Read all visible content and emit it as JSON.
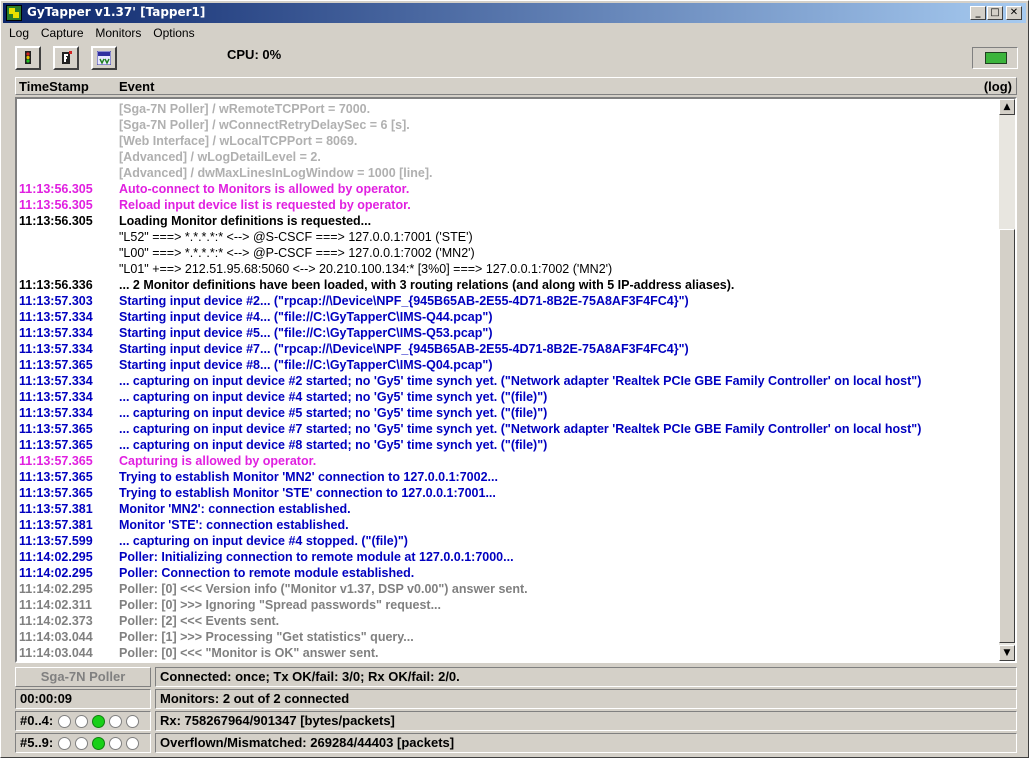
{
  "window": {
    "title": "GyTapper  v1.37'  [Tapper1]",
    "controls": {
      "minimize": "_",
      "maximize": "□",
      "close": "✕"
    }
  },
  "menu": [
    "Log",
    "Capture",
    "Monitors",
    "Options"
  ],
  "toolbar": {
    "buttons": [
      "traffic-light-icon",
      "phone-f-icon",
      "auto-capture-icon"
    ],
    "cpu_label": "CPU:  0%",
    "connection_icon": "plug-icon"
  },
  "log": {
    "columns": {
      "timestamp": "TimeStamp",
      "event": "Event",
      "right": "(log)"
    },
    "lines": [
      {
        "ts": "",
        "ev": "[Sga-7N Poller] / wRemoteTCPPort = 7000.",
        "color": "lightgray"
      },
      {
        "ts": "",
        "ev": "[Sga-7N Poller] / wConnectRetryDelaySec = 6 [s].",
        "color": "lightgray"
      },
      {
        "ts": "",
        "ev": "[Web Interface] / wLocalTCPPort = 8069.",
        "color": "lightgray"
      },
      {
        "ts": "",
        "ev": "[Advanced] / wLogDetailLevel = 2.",
        "color": "lightgray"
      },
      {
        "ts": "",
        "ev": "[Advanced] / dwMaxLinesInLogWindow = 1000 [line].",
        "color": "lightgray"
      },
      {
        "ts": "11:13:56.305",
        "ev": "Auto-connect to Monitors is allowed by operator.",
        "color": "magenta"
      },
      {
        "ts": "11:13:56.305",
        "ev": "Reload input device list is requested by operator.",
        "color": "magenta"
      },
      {
        "ts": "11:13:56.305",
        "ev": "Loading Monitor definitions is requested...",
        "color": "black"
      },
      {
        "ts": "",
        "ev": "\"L52\"  ===>  *.*.*.*:* <--> @S-CSCF  ===>  127.0.0.1:7001 ('STE')",
        "color": "black",
        "normal": true
      },
      {
        "ts": "",
        "ev": "\"L00\"  ===>  *.*.*.*:* <--> @P-CSCF  ===>  127.0.0.1:7002 ('MN2')",
        "color": "black",
        "normal": true
      },
      {
        "ts": "",
        "ev": "\"L01\"  +==>  212.51.95.68:5060 <--> 20.210.100.134:*  [3%0]  ===>  127.0.0.1:7002 ('MN2')",
        "color": "black",
        "normal": true
      },
      {
        "ts": "11:13:56.336",
        "ev": "... 2 Monitor definitions have been loaded, with 3 routing relations (and along with 5 IP-address aliases).",
        "color": "black"
      },
      {
        "ts": "11:13:57.303",
        "ev": "Starting input device #2...  (\"rpcap://\\Device\\NPF_{945B65AB-2E55-4D71-8B2E-75A8AF3F4FC4}\")",
        "color": "blue"
      },
      {
        "ts": "11:13:57.334",
        "ev": "Starting input device #4...  (\"file://C:\\GyTapperC\\IMS-Q44.pcap\")",
        "color": "blue"
      },
      {
        "ts": "11:13:57.334",
        "ev": "Starting input device #5...  (\"file://C:\\GyTapperC\\IMS-Q53.pcap\")",
        "color": "blue"
      },
      {
        "ts": "11:13:57.334",
        "ev": "Starting input device #7...  (\"rpcap://\\Device\\NPF_{945B65AB-2E55-4D71-8B2E-75A8AF3F4FC4}\")",
        "color": "blue"
      },
      {
        "ts": "11:13:57.365",
        "ev": "Starting input device #8...  (\"file://C:\\GyTapperC\\IMS-Q04.pcap\")",
        "color": "blue"
      },
      {
        "ts": "11:13:57.334",
        "ev": "... capturing on input device #2 started; no 'Gy5' time synch yet.  (\"Network adapter 'Realtek PCIe GBE Family Controller' on local host\")",
        "color": "blue"
      },
      {
        "ts": "11:13:57.334",
        "ev": "... capturing on input device #4 started; no 'Gy5' time synch yet.  (\"(file)\")",
        "color": "blue"
      },
      {
        "ts": "11:13:57.334",
        "ev": "... capturing on input device #5 started; no 'Gy5' time synch yet.  (\"(file)\")",
        "color": "blue"
      },
      {
        "ts": "11:13:57.365",
        "ev": "... capturing on input device #7 started; no 'Gy5' time synch yet.  (\"Network adapter 'Realtek PCIe GBE Family Controller' on local host\")",
        "color": "blue"
      },
      {
        "ts": "11:13:57.365",
        "ev": "... capturing on input device #8 started; no 'Gy5' time synch yet.  (\"(file)\")",
        "color": "blue"
      },
      {
        "ts": "11:13:57.365",
        "ev": "Capturing is allowed by operator.",
        "color": "magenta"
      },
      {
        "ts": "11:13:57.365",
        "ev": "Trying to establish Monitor 'MN2' connection to 127.0.0.1:7002...",
        "color": "blue"
      },
      {
        "ts": "11:13:57.365",
        "ev": "Trying to establish Monitor 'STE' connection to 127.0.0.1:7001...",
        "color": "blue"
      },
      {
        "ts": "11:13:57.381",
        "ev": "Monitor 'MN2': connection established.",
        "color": "blue"
      },
      {
        "ts": "11:13:57.381",
        "ev": "Monitor 'STE': connection established.",
        "color": "blue"
      },
      {
        "ts": "11:13:57.599",
        "ev": "... capturing on input device #4 stopped.  (\"(file)\")",
        "color": "blue"
      },
      {
        "ts": "11:14:02.295",
        "ev": "Poller: Initializing connection to remote module at 127.0.0.1:7000...",
        "color": "blue"
      },
      {
        "ts": "11:14:02.295",
        "ev": "Poller: Connection to remote module established.",
        "color": "blue"
      },
      {
        "ts": "11:14:02.295",
        "ev": "Poller: [0] <<< Version info (\"Monitor v1.37, DSP v0.00\") answer sent.",
        "color": "gray"
      },
      {
        "ts": "11:14:02.311",
        "ev": "Poller: [0] >>> Ignoring \"Spread passwords\" request...",
        "color": "gray"
      },
      {
        "ts": "11:14:02.373",
        "ev": "Poller: [2] <<< Events sent.",
        "color": "gray"
      },
      {
        "ts": "11:14:03.044",
        "ev": "Poller: [1] >>> Processing \"Get statistics\" query...",
        "color": "gray"
      },
      {
        "ts": "11:14:03.044",
        "ev": "Poller: [0] <<< \"Monitor is OK\" answer sent.",
        "color": "gray"
      }
    ]
  },
  "status": {
    "poller_label": "Sga-7N Poller",
    "poller_status": "Connected: once;  Tx OK/fail: 3/0;  Rx OK/fail: 2/0.",
    "uptime": "00:00:09",
    "monitors": "Monitors: 2 out of 2 connected",
    "group1_label": "#0..4:",
    "group1_leds": [
      false,
      false,
      true,
      false,
      false
    ],
    "rx": "Rx: 758267964/901347 [bytes/packets]",
    "group2_label": "#5..9:",
    "group2_leds": [
      false,
      false,
      true,
      false,
      false
    ],
    "overflow": "Overflown/Mismatched: 269284/44403 [packets]"
  }
}
